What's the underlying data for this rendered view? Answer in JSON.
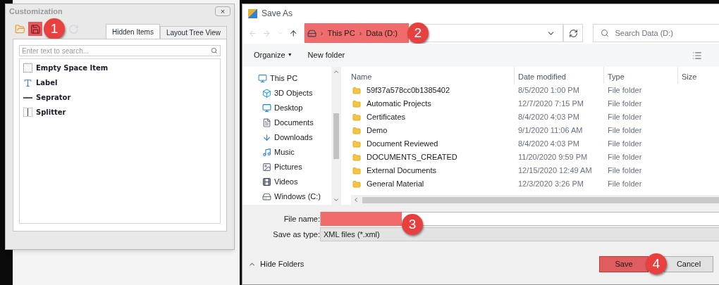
{
  "customization": {
    "title": "Customization",
    "close": "×",
    "toolbar": [
      {
        "kind": "open",
        "highlighted": false
      },
      {
        "kind": "save",
        "highlighted": true
      },
      {
        "kind": "redo",
        "highlighted": false
      }
    ],
    "tabs": [
      {
        "label": "Hidden Items",
        "selected": true
      },
      {
        "label": "Layout Tree View",
        "selected": false
      }
    ],
    "search": {
      "placeholder": "Enter text to search..."
    },
    "items": [
      {
        "kind": "empty",
        "label": "Empty Space Item"
      },
      {
        "kind": "label",
        "label": "Label"
      },
      {
        "kind": "separator",
        "label": "Seprator"
      },
      {
        "kind": "splitter",
        "label": "Splitter"
      }
    ]
  },
  "save_as": {
    "title": "Save As",
    "breadcrumb": {
      "highlighted": true,
      "separator": "›",
      "parts": [
        "This PC",
        "Data (D:)"
      ]
    },
    "organize_caret": "▼",
    "search": {
      "placeholder": "Search Data (D:)"
    },
    "toolbar": [
      "Organize",
      "New folder"
    ],
    "sidebar": [
      {
        "kind": "pc",
        "label": "This PC"
      },
      {
        "kind": "cube",
        "label": "3D Objects"
      },
      {
        "kind": "desktop",
        "label": "Desktop"
      },
      {
        "kind": "documents",
        "label": "Documents"
      },
      {
        "kind": "downloads",
        "label": "Downloads"
      },
      {
        "kind": "music",
        "label": "Music"
      },
      {
        "kind": "pictures",
        "label": "Pictures"
      },
      {
        "kind": "videos",
        "label": "Videos"
      },
      {
        "kind": "drive",
        "label": "Windows (C:)"
      }
    ],
    "columns": [
      "Name",
      "Date modified",
      "Type",
      "Size"
    ],
    "rows": [
      {
        "name": "59f37a578cc0b1385402",
        "date": "8/5/2020 1:00 PM",
        "type": "File folder"
      },
      {
        "name": "Automatic Projects",
        "date": "12/7/2020 7:15 PM",
        "type": "File folder"
      },
      {
        "name": "Certificates",
        "date": "8/4/2020 4:03 PM",
        "type": "File folder"
      },
      {
        "name": "Demo",
        "date": "9/1/2020 11:06 AM",
        "type": "File folder"
      },
      {
        "name": "Document Reviewed",
        "date": "8/4/2020 4:03 PM",
        "type": "File folder"
      },
      {
        "name": "DOCUMENTS_CREATED",
        "date": "11/20/2020 9:59 PM",
        "type": "File folder"
      },
      {
        "name": "External Documents",
        "date": "12/15/2020 12:49 AM",
        "type": "File folder"
      },
      {
        "name": "General Material",
        "date": "12/3/2020 3:26 PM",
        "type": "File folder"
      }
    ],
    "file_name": {
      "label": "File name:",
      "highlighted": true
    },
    "save_type": {
      "label": "Save as type:",
      "value": "XML files (*.xml)"
    },
    "hide_folders": "Hide Folders",
    "buttons": [
      {
        "label": "Save",
        "highlighted": true
      },
      {
        "label": "Cancel",
        "highlighted": false
      }
    ]
  },
  "steps": [
    "1",
    "2",
    "3",
    "4"
  ]
}
